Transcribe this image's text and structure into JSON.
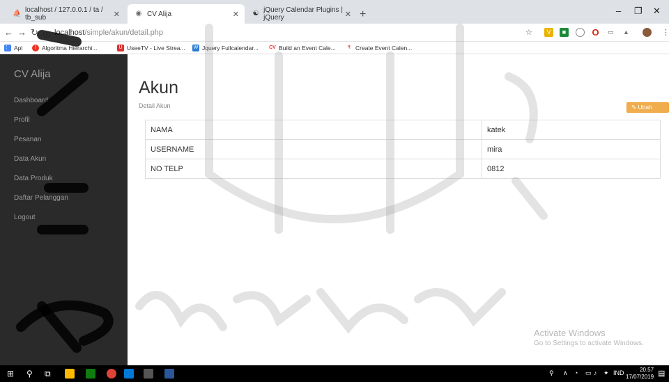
{
  "browser": {
    "tabs": [
      {
        "title": "localhost / 127.0.0.1 / ta / tb_sub"
      },
      {
        "title": "CV Alija"
      },
      {
        "title": "jQuery Calendar Plugins | jQuery"
      }
    ],
    "new_tab": "+",
    "url_host": "localhost",
    "url_path": "/simple/akun/detail.php",
    "bookmarks": [
      {
        "label": "Apl"
      },
      {
        "label": "Algoritma Hierarchi..."
      },
      {
        "label": "UseeTV - Live Strea..."
      },
      {
        "label": "Jquery Fullcalendar..."
      },
      {
        "label": "Build an Event Cale..."
      },
      {
        "label": "Create Event Calen..."
      }
    ]
  },
  "sidebar": {
    "brand": "CV Alija",
    "items": [
      {
        "label": "Dashboard"
      },
      {
        "label": "Profil"
      },
      {
        "label": "Pesanan"
      },
      {
        "label": "Data Akun"
      },
      {
        "label": "Data Produk"
      },
      {
        "label": "Daftar Pelanggan"
      },
      {
        "label": "Logout"
      }
    ]
  },
  "main": {
    "title": "Akun",
    "subtitle": "Detail Akun",
    "edit_button": "Ubah Data",
    "rows": [
      {
        "label": "NAMA",
        "value": "katek"
      },
      {
        "label": "USERNAME",
        "value": "mira"
      },
      {
        "label": "NO TELP",
        "value": "0812"
      }
    ]
  },
  "watermark": {
    "title": "Activate Windows",
    "subtitle": "Go to Settings to activate Windows."
  },
  "taskbar": {
    "language": "IND",
    "time": "20.57",
    "date": "17/07/2019"
  },
  "colors": {
    "sidebar": "#2a2a2a",
    "accent_button": "#f0ad4e",
    "taskbar": "#000000"
  }
}
